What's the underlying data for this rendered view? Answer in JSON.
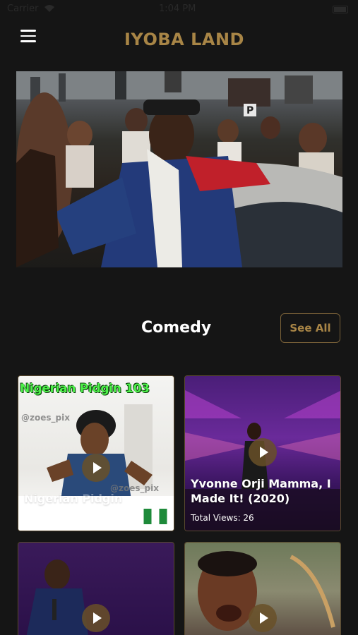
{
  "status_bar": {
    "carrier": "Carrier",
    "time": "1:04 PM"
  },
  "header": {
    "logo_text": "IYOBA LAND",
    "menu_icon": "hamburger-menu-icon"
  },
  "section": {
    "title": "Comedy",
    "see_all_label": "See All"
  },
  "cards": [
    {
      "banner": "Nigerian Pidgin 103",
      "watermark": "@zoes_pix",
      "watermark2": "@zoes_pix",
      "caption": "Nigerian Pidgin",
      "flag": "nigeria-flag-icon"
    },
    {
      "title_line1": "Yvonne Orji   Mamma, I",
      "title_line2": "Made It! (2020)",
      "views": "Total Views: 26"
    },
    {
      "title": ""
    },
    {
      "title": ""
    }
  ],
  "colors": {
    "background": "#151515",
    "accent_gold": "#a88546",
    "border_gold": "#7a6138"
  }
}
